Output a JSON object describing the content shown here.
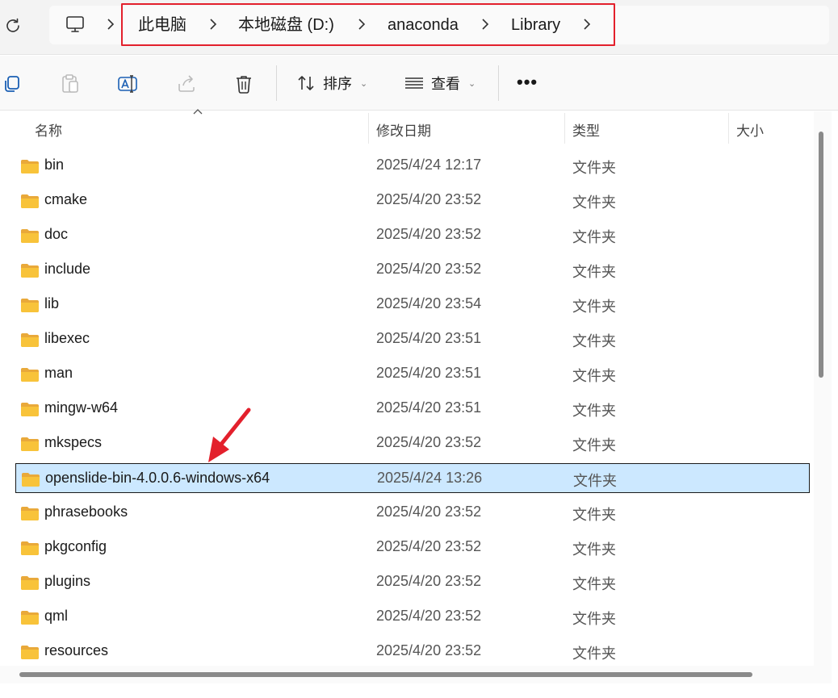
{
  "address_bar": {
    "breadcrumbs": [
      {
        "label": "此电脑"
      },
      {
        "label": "本地磁盘 (D:)"
      },
      {
        "label": "anaconda"
      },
      {
        "label": "Library"
      }
    ]
  },
  "toolbar": {
    "sort_label": "排序",
    "view_label": "查看",
    "more_label": "•••"
  },
  "columns": {
    "name": "名称",
    "date": "修改日期",
    "type": "类型",
    "size": "大小"
  },
  "files": [
    {
      "name": "bin",
      "date": "2025/4/24 12:17",
      "type": "文件夹"
    },
    {
      "name": "cmake",
      "date": "2025/4/20 23:52",
      "type": "文件夹"
    },
    {
      "name": "doc",
      "date": "2025/4/20 23:52",
      "type": "文件夹"
    },
    {
      "name": "include",
      "date": "2025/4/20 23:52",
      "type": "文件夹"
    },
    {
      "name": "lib",
      "date": "2025/4/20 23:54",
      "type": "文件夹"
    },
    {
      "name": "libexec",
      "date": "2025/4/20 23:51",
      "type": "文件夹"
    },
    {
      "name": "man",
      "date": "2025/4/20 23:51",
      "type": "文件夹"
    },
    {
      "name": "mingw-w64",
      "date": "2025/4/20 23:51",
      "type": "文件夹"
    },
    {
      "name": "mkspecs",
      "date": "2025/4/20 23:52",
      "type": "文件夹"
    },
    {
      "name": "openslide-bin-4.0.0.6-windows-x64",
      "date": "2025/4/24 13:26",
      "type": "文件夹",
      "selected": true
    },
    {
      "name": "phrasebooks",
      "date": "2025/4/20 23:52",
      "type": "文件夹"
    },
    {
      "name": "pkgconfig",
      "date": "2025/4/20 23:52",
      "type": "文件夹"
    },
    {
      "name": "plugins",
      "date": "2025/4/20 23:52",
      "type": "文件夹"
    },
    {
      "name": "qml",
      "date": "2025/4/20 23:52",
      "type": "文件夹"
    },
    {
      "name": "resources",
      "date": "2025/4/20 23:52",
      "type": "文件夹"
    }
  ],
  "colors": {
    "selection_bg": "#cce8ff",
    "annotation_red": "#e3202c",
    "folder_yellow": "#f8c33a"
  }
}
